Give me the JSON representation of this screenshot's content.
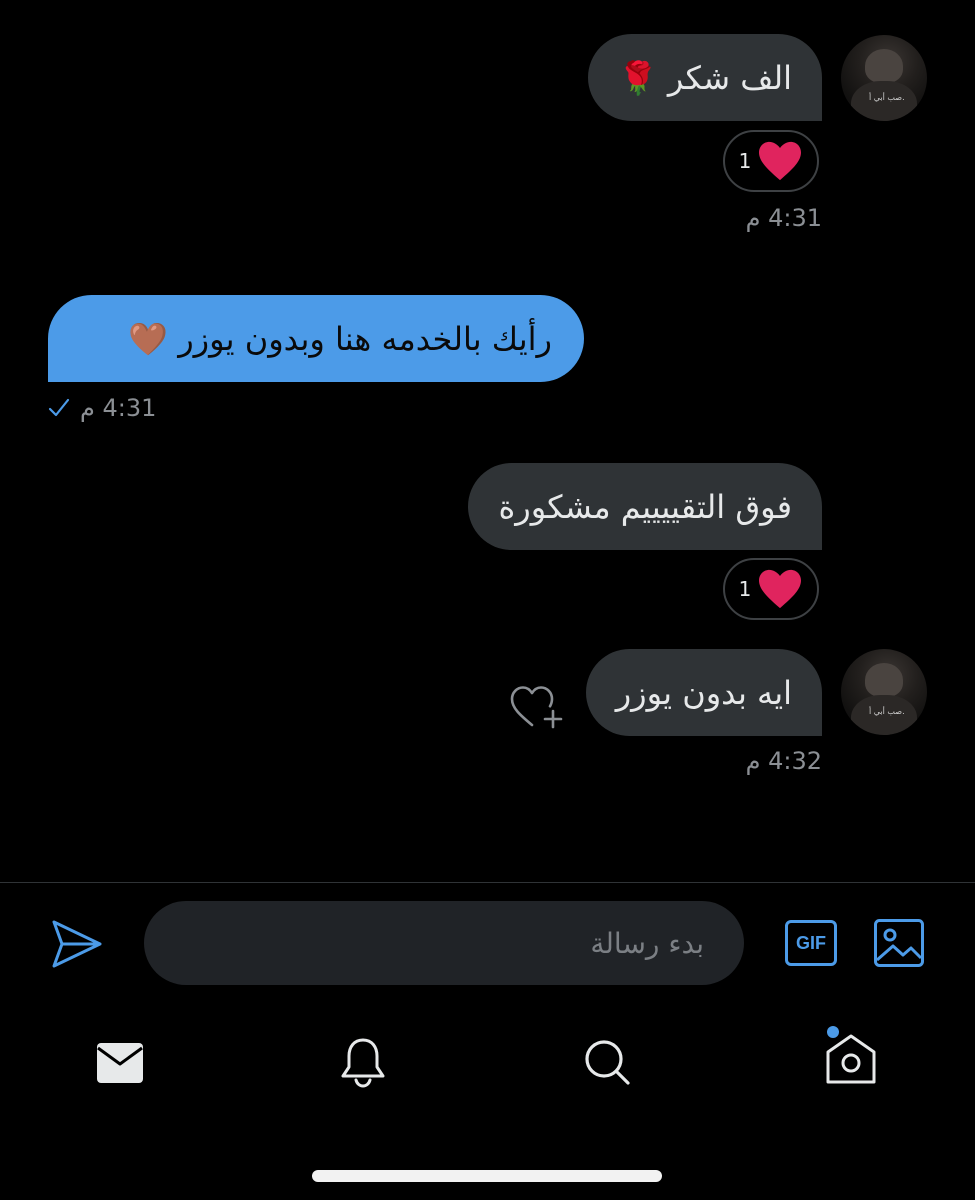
{
  "messages": [
    {
      "text": "الف شكر",
      "emoji": "🌹",
      "reaction": {
        "emoji": "❤️",
        "count": "1"
      },
      "time": "4:31 م"
    },
    {
      "text": "رأيك بالخدمه هنا  وبدون يوزر",
      "emoji": "🤎",
      "time": "4:31 م"
    },
    {
      "text": "فوق التقييييم مشكورة",
      "reaction": {
        "emoji": "❤️",
        "count": "1"
      }
    },
    {
      "text": "ايه بدون يوزر",
      "time": "4:32 م"
    }
  ],
  "avatar_signature": "صب أبي أ.",
  "composer": {
    "placeholder": "بدء رسالة",
    "gif_label": "GIF"
  },
  "colors": {
    "accent": "#4c9be8",
    "incoming_bubble": "#2f3336",
    "heart": "#e0245e",
    "background": "#000000"
  },
  "icons": {
    "send": "send-icon",
    "gif": "gif-icon",
    "image": "image-icon",
    "add_reaction": "heart-plus-icon",
    "nav": [
      "mail-icon",
      "bell-icon",
      "search-icon",
      "home-icon"
    ]
  }
}
